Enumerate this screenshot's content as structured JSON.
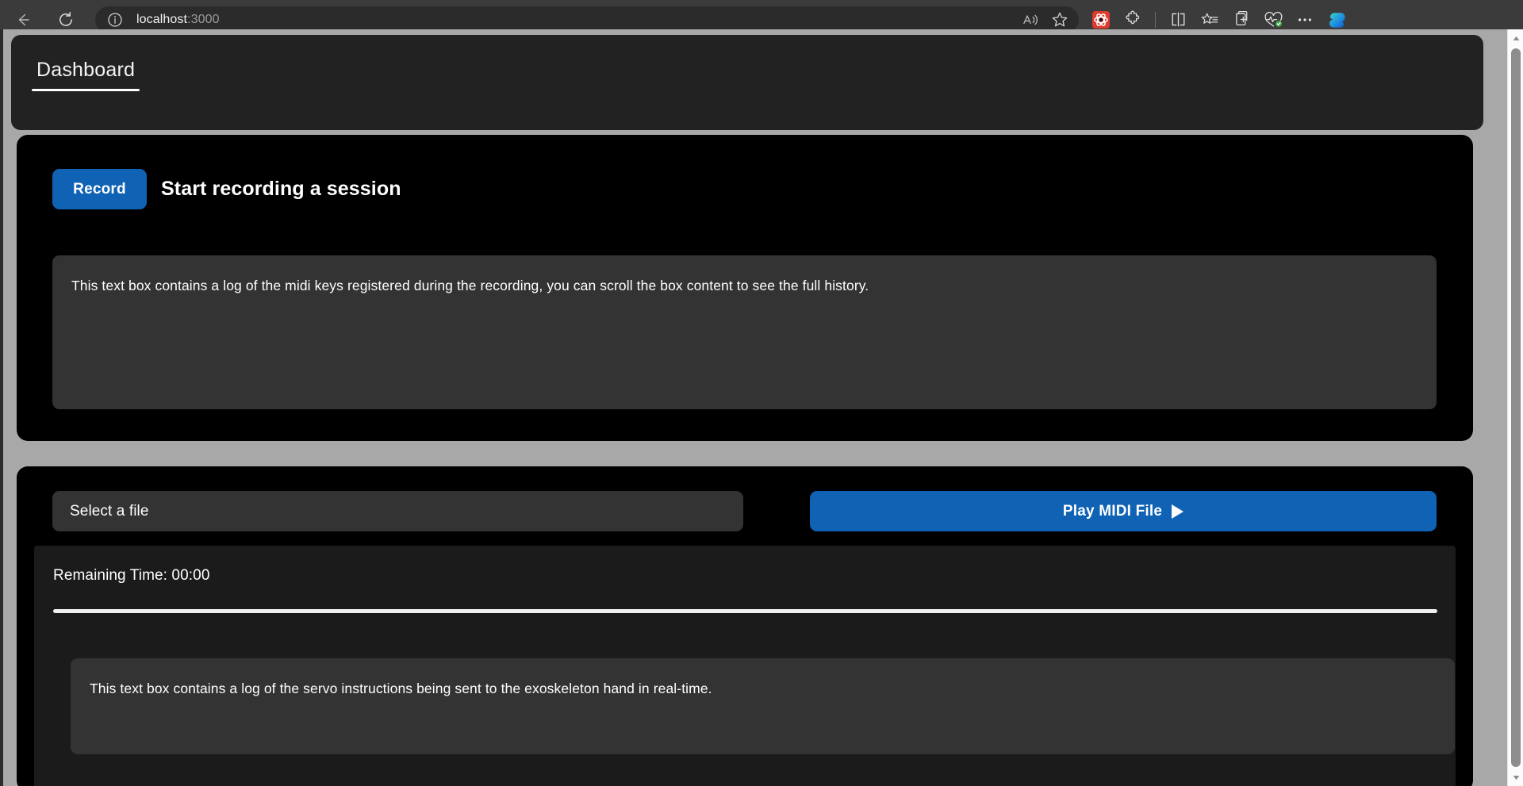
{
  "browser": {
    "back_label": "Back",
    "refresh_label": "Refresh",
    "url_host": "localhost",
    "url_port": ":3000",
    "read_aloud_label": "Read aloud",
    "favorite_label": "Add this page to favorites",
    "extension_label": "Extension",
    "extensions_label": "Extensions",
    "split_screen_label": "Split screen",
    "favorites_label": "Favorites",
    "collections_label": "Collections",
    "browser_essentials_label": "Browser essentials",
    "settings_more_label": "Settings and more",
    "copilot_label": "Copilot"
  },
  "app": {
    "tabs": [
      {
        "label": "Dashboard",
        "active": true
      }
    ]
  },
  "record_card": {
    "button_label": "Record",
    "title": "Start recording a session",
    "log_value": "This text box contains a log of the midi keys registered during the recording, you can scroll the box content to see the full history.",
    "log_placeholder": "This text box contains a log of the midi keys registered during the recording, you can scroll the box content to see the full history."
  },
  "play_card": {
    "file_select_label": "Select a file",
    "play_button_label": "Play MIDI File",
    "play_icon": "play-triangle-icon",
    "remaining_time_label": "Remaining Time: 00:00",
    "progress_percent": 0,
    "servo_log_value": "This text box contains a log of the servo instructions being sent to the exoskeleton hand in real-time.",
    "servo_log_placeholder": "This text box contains a log of the servo instructions being sent to the exoskeleton hand in real-time."
  },
  "colors": {
    "accent_blue": "#0f62b4",
    "page_background": "#a8a8a8",
    "card_background": "#000000",
    "panel_background": "#1b1b1b",
    "textbox_background": "#333333",
    "topbar_background": "#222222"
  },
  "scrollbar": {
    "up_arrow": "scroll-up-arrow-icon",
    "down_arrow": "scroll-down-arrow-icon"
  }
}
